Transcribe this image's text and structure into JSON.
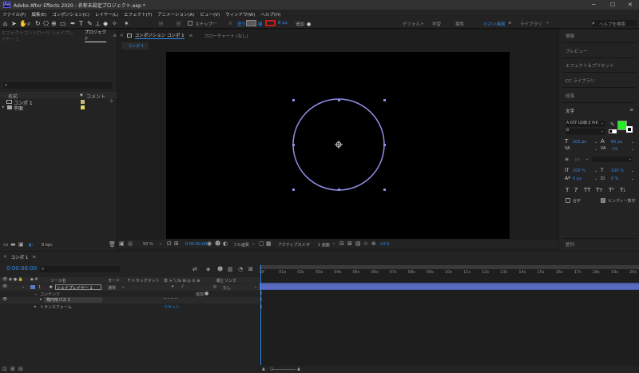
{
  "app": {
    "logo": "Ae",
    "title": "Adobe After Effects 2020 - 名称未設定プロジェクト.aep *"
  },
  "window_controls": {
    "minimize": "─",
    "maximize": "☐",
    "close": "✕"
  },
  "menu": [
    "ファイル(F)",
    "編集(E)",
    "コンポジション(C)",
    "レイヤー(L)",
    "エフェクト(T)",
    "アニメーション(A)",
    "ビュー(V)",
    "ウィンドウ(W)",
    "ヘルプ(H)"
  ],
  "toolbar": {
    "snap_label": "スナップ",
    "fill_label": "塗り",
    "stroke_label": "線",
    "stroke_width": "8 px",
    "add_label": "追加",
    "fill_color": "#5a5a5a",
    "stroke_color": "#cc1a1a",
    "workspaces": [
      "デフォルト",
      "学習",
      "標準",
      "小さい画面",
      "ライブラリ"
    ],
    "active_workspace": "小さい画面",
    "search_placeholder": "ヘルプを検索"
  },
  "left_panel": {
    "tab_effect_controls": "エフェクトコントロール シェイプレイヤー 1",
    "tab_project": "プロジェクト",
    "search_icon": "⌕",
    "columns": [
      "名前",
      "コメント"
    ],
    "items": [
      {
        "name": "コンポ 1",
        "color": "#c8b87a"
      },
      {
        "name": "平面",
        "color": "#e6d860"
      }
    ],
    "bpc": "8 bpc"
  },
  "viewer": {
    "tab_comp": "コンポジション コンポ 1",
    "tab_flowchart": "フローチャート (なし)",
    "comp_chip": "コンポ 1",
    "zoom": "50 %",
    "timecode": "0:00:00:00",
    "resolution": "フル画質",
    "camera": "アクティブカメラ",
    "views": "1 画面",
    "exposure": "+0.0"
  },
  "right_panel": {
    "items": [
      "情報",
      "プレビュー",
      "エフェクト＆プリセット",
      "CC ライブラリ",
      "段落"
    ],
    "character_title": "文字",
    "font_name": "A-OTF UD新ゴ Pr6",
    "font_style": "B",
    "font_size": "202 px",
    "leading": "80 px",
    "tracking": "-15",
    "stroke_unit": "px",
    "vert_scale": "100 %",
    "horiz_scale": "100 %",
    "baseline": "0 px",
    "tsume": "0 %",
    "style_buttons": [
      "T",
      "T",
      "TT",
      "Tт",
      "T¹",
      "T₁"
    ],
    "ligature_label": "合字",
    "hindi_label": "ヒンディー数字",
    "fill_swatch": "#22ee22",
    "align_label": "整列"
  },
  "timeline": {
    "tab": "コンポ 1",
    "timecode": "0:00:00:00",
    "columns": {
      "source": "ソース名",
      "mode": "モード",
      "trkmat": "T トラックマット",
      "switches": "单 ☀ ╲ fx ⊞ ◎ ⊙ ⊕",
      "parent": "親とリンク"
    },
    "layer": {
      "index": "1",
      "name": "シェイプレイヤー 1",
      "mode": "通常",
      "parent": "なし"
    },
    "contents_label": "コンテンツ",
    "add_label": "追加",
    "ellipse_label": "楕円形パス 1",
    "ellipse_mode": "─ ─ ─ ─",
    "transform_label": "トランスフォーム",
    "reset_label": "リセット",
    "ruler": [
      "0f",
      "01s",
      "02s",
      "03s",
      "04s",
      "05s",
      "06s",
      "07s",
      "08s",
      "09s",
      "10s",
      "11s",
      "12s",
      "13s",
      "14s",
      "15s",
      "16s",
      "17s",
      "18s",
      "19s",
      "20s"
    ]
  }
}
